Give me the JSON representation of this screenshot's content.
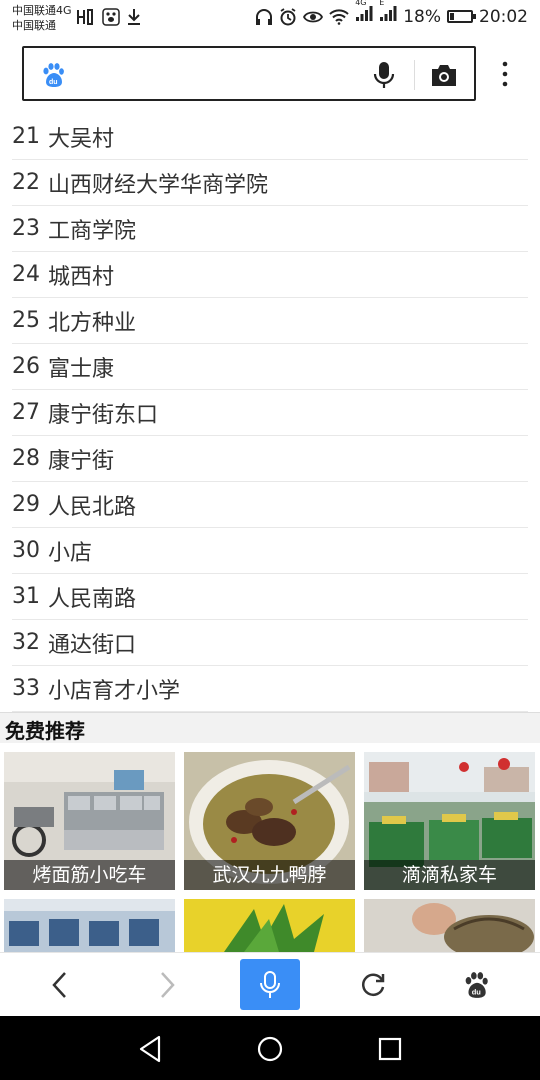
{
  "status_bar": {
    "carrier_1": "中国联通4G",
    "carrier_2": "中国联通",
    "signal_label_1": "4G",
    "signal_label_2": "E",
    "battery": "18%",
    "battery_level": 0.18,
    "time": "20:02"
  },
  "search": {
    "logo_icon": "baidu-paw-icon",
    "voice_icon": "microphone-icon",
    "camera_icon": "camera-icon",
    "menu_icon": "more-vertical-icon"
  },
  "list": [
    {
      "num": "21",
      "text": "大吴村"
    },
    {
      "num": "22",
      "text": "山西财经大学华商学院"
    },
    {
      "num": "23",
      "text": "工商学院"
    },
    {
      "num": "24",
      "text": "城西村"
    },
    {
      "num": "25",
      "text": "北方种业"
    },
    {
      "num": "26",
      "text": "富士康"
    },
    {
      "num": "27",
      "text": "康宁街东口"
    },
    {
      "num": "28",
      "text": "康宁街"
    },
    {
      "num": "29",
      "text": "人民北路"
    },
    {
      "num": "30",
      "text": "小店"
    },
    {
      "num": "31",
      "text": "人民南路"
    },
    {
      "num": "32",
      "text": "通达街口"
    },
    {
      "num": "33",
      "text": "小店育才小学"
    }
  ],
  "recommend": {
    "title": "免费推荐",
    "cards": [
      {
        "caption": "烤面筋小吃车"
      },
      {
        "caption": "武汉九九鸭脖"
      },
      {
        "caption": "滴滴私家车"
      }
    ]
  },
  "toolbar": {
    "back_icon": "chevron-left-icon",
    "forward_icon": "chevron-right-icon",
    "voice_icon": "microphone-icon",
    "refresh_icon": "refresh-icon",
    "home_icon": "baidu-paw-icon",
    "accent": "#3a8ef6"
  },
  "nav": {
    "back_icon": "triangle-back-icon",
    "home_icon": "circle-home-icon",
    "recent_icon": "square-recent-icon"
  }
}
